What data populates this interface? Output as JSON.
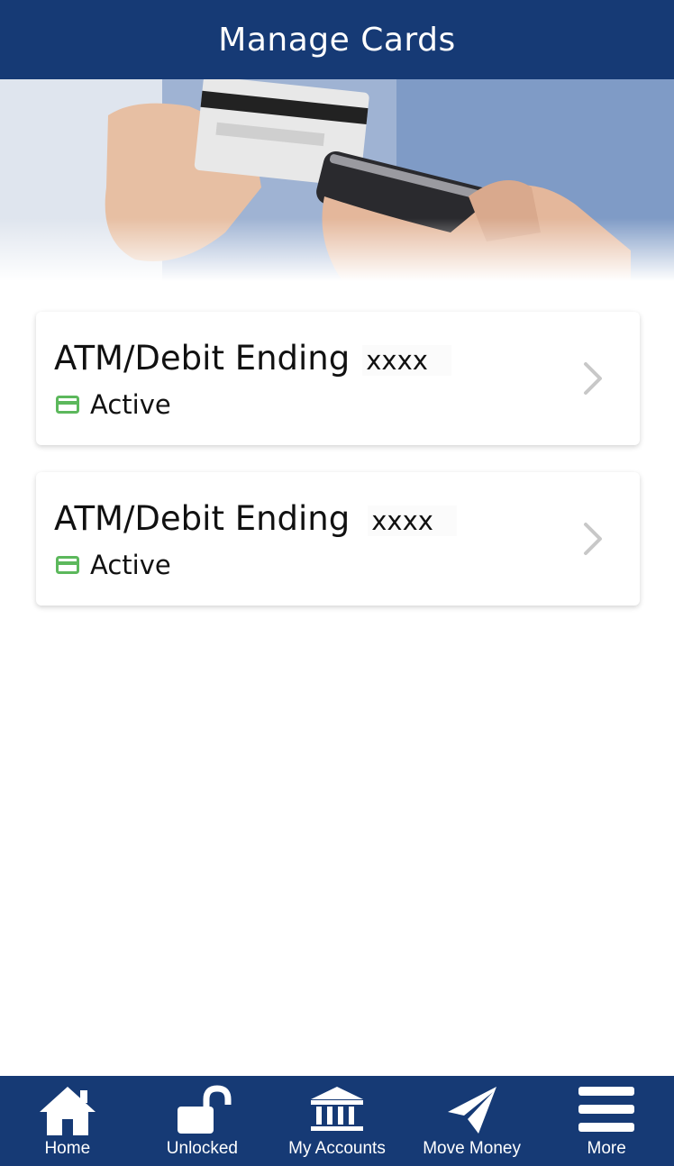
{
  "header": {
    "title": "Manage Cards"
  },
  "cards": [
    {
      "title": "ATM/Debit Ending",
      "mask": "xxxx",
      "status": "Active"
    },
    {
      "title": "ATM/Debit Ending",
      "mask": "xxxx",
      "status": "Active"
    }
  ],
  "nav": {
    "items": [
      {
        "label": "Home",
        "icon": "home-icon"
      },
      {
        "label": "Unlocked",
        "icon": "unlocked-icon"
      },
      {
        "label": "My Accounts",
        "icon": "bank-icon"
      },
      {
        "label": "Move Money",
        "icon": "paper-plane-icon"
      },
      {
        "label": "More",
        "icon": "menu-icon"
      }
    ]
  },
  "colors": {
    "header_bg": "#163a75",
    "status_active": "#5cb85c",
    "chevron": "#c8c8c8"
  }
}
